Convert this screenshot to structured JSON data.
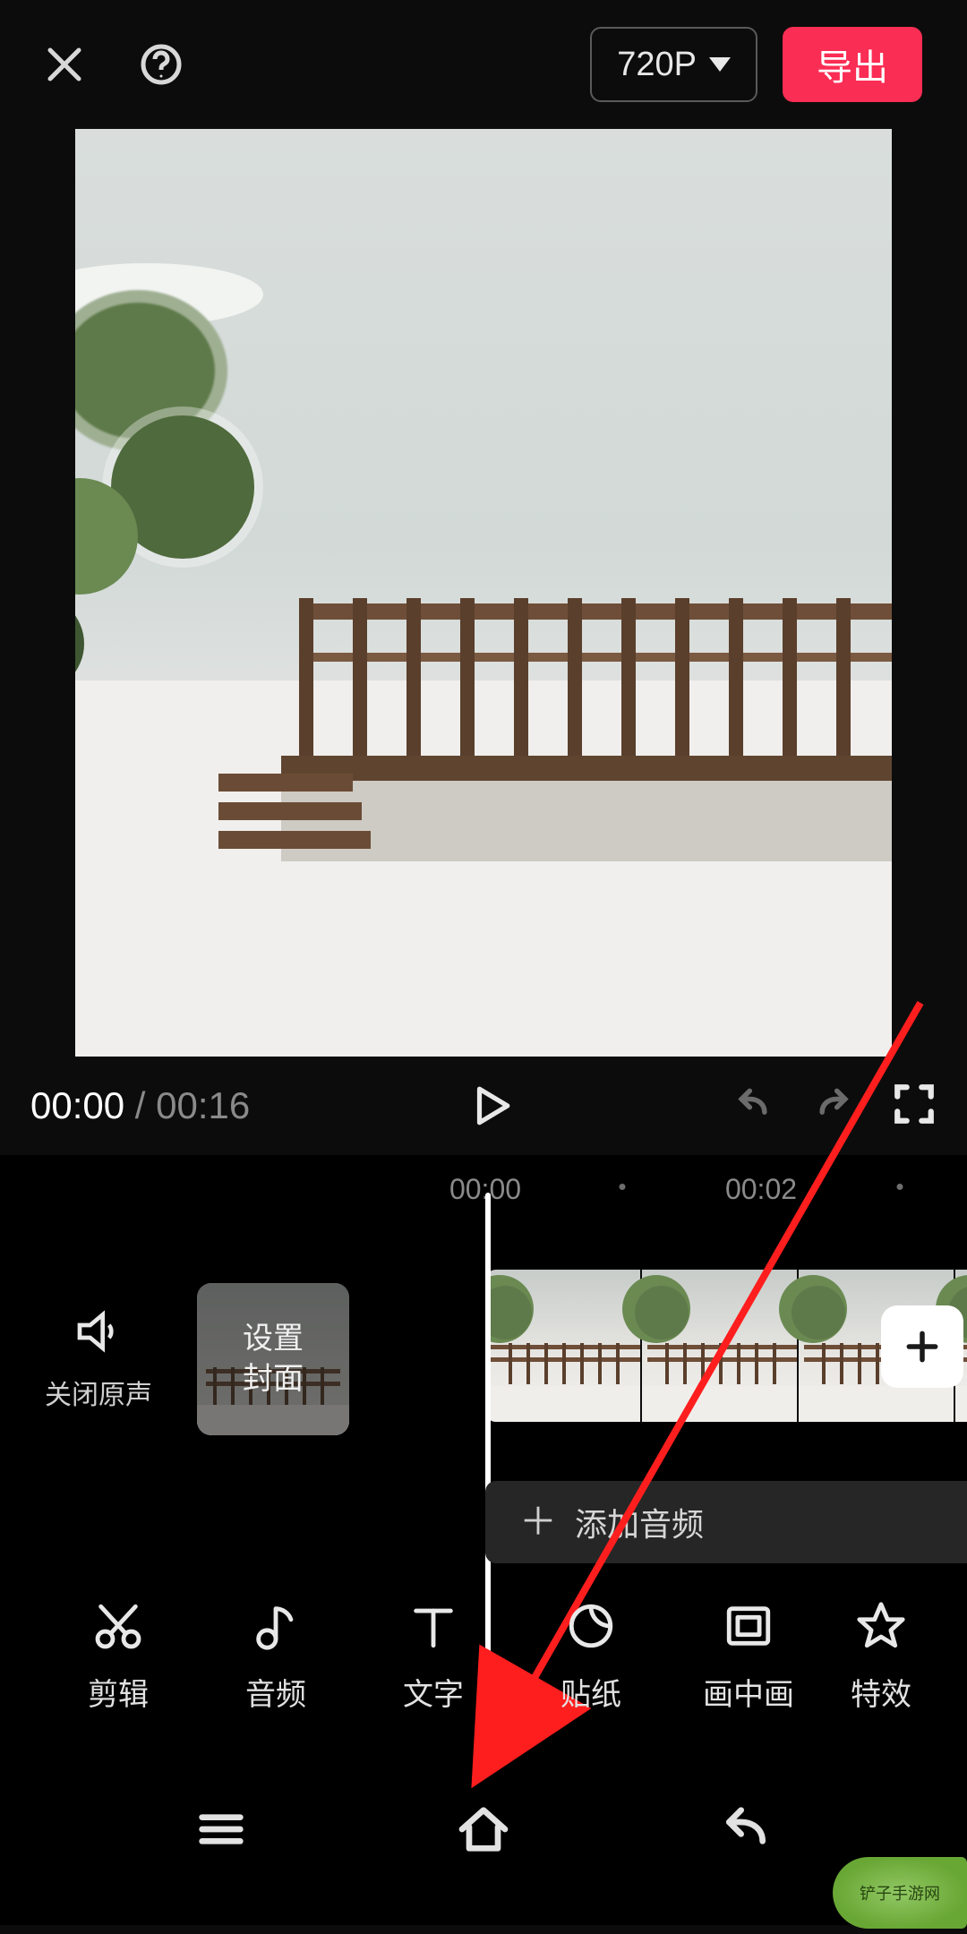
{
  "topbar": {
    "resolution_label": "720P",
    "export_label": "导出"
  },
  "playback": {
    "current_time": "00:00",
    "separator": " / ",
    "duration": "00:16"
  },
  "timeline": {
    "ruler_labels": [
      "00:00",
      "00:02"
    ],
    "mute_label": "关闭原声",
    "cover_label_line1": "设置",
    "cover_label_line2": "封面",
    "add_audio_label": "添加音频"
  },
  "toolbar": {
    "items": [
      {
        "id": "edit",
        "label": "剪辑"
      },
      {
        "id": "audio",
        "label": "音频"
      },
      {
        "id": "text",
        "label": "文字"
      },
      {
        "id": "sticker",
        "label": "贴纸"
      },
      {
        "id": "pip",
        "label": "画中画"
      },
      {
        "id": "effect",
        "label": "特效"
      }
    ]
  },
  "watermark_text": "铲子手游网"
}
